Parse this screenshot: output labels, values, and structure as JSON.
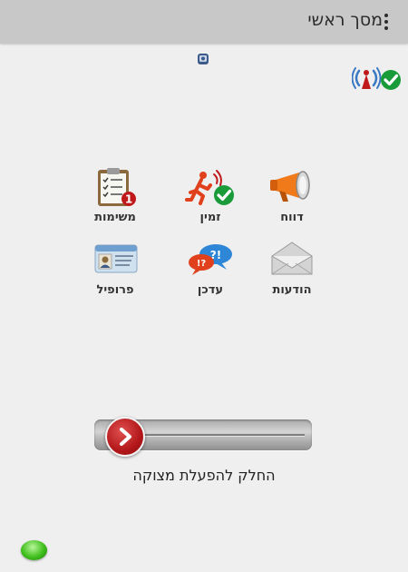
{
  "header": {
    "title": "מסך ראשי",
    "menu_icon": "more-vert-icon"
  },
  "status": {
    "connection_icon": "signal-check-icon",
    "top_icon": "device-shield-icon"
  },
  "grid": {
    "items": [
      {
        "label": "דווח",
        "icon": "megaphone-icon"
      },
      {
        "label": "זמין",
        "icon": "running-person-check-icon"
      },
      {
        "label": "משימות",
        "icon": "clipboard-checklist-icon",
        "badge": "1"
      },
      {
        "label": "הודעות",
        "icon": "envelope-icon"
      },
      {
        "label": "עדכן",
        "icon": "speech-bubbles-icon"
      },
      {
        "label": "פרופיל",
        "icon": "id-card-icon"
      }
    ]
  },
  "panic": {
    "label": "החלק להפעלת מצוקה",
    "knob_icon": "chevron-right-icon"
  },
  "indicator": {
    "icon": "green-led-icon"
  },
  "colors": {
    "appbar": "#c8c8c8",
    "background": "#efefef",
    "accent_red": "#c0191b",
    "check_green": "#1a9b3a",
    "megaphone_orange": "#f07a1a"
  }
}
